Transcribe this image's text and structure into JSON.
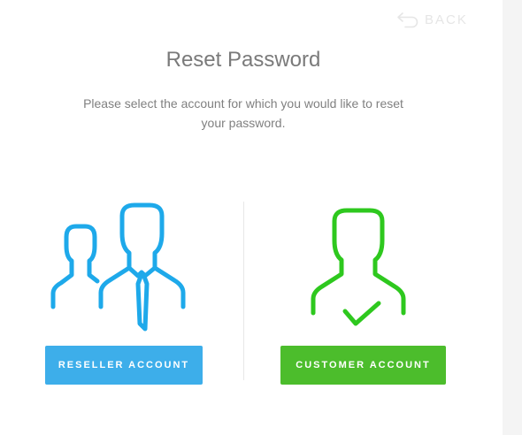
{
  "header": {
    "back_label": "BACK",
    "back_icon": "undo-arrow-icon"
  },
  "main": {
    "title": "Reset Password",
    "instruction": "Please select the account for which you would like to reset your password."
  },
  "options": {
    "reseller": {
      "icon": "users-with-tie-icon",
      "button_label": "RESELLER ACCOUNT",
      "color": "#3daeea"
    },
    "customer": {
      "icon": "user-check-icon",
      "button_label": "CUSTOMER ACCOUNT",
      "color": "#4cbd2c"
    }
  }
}
